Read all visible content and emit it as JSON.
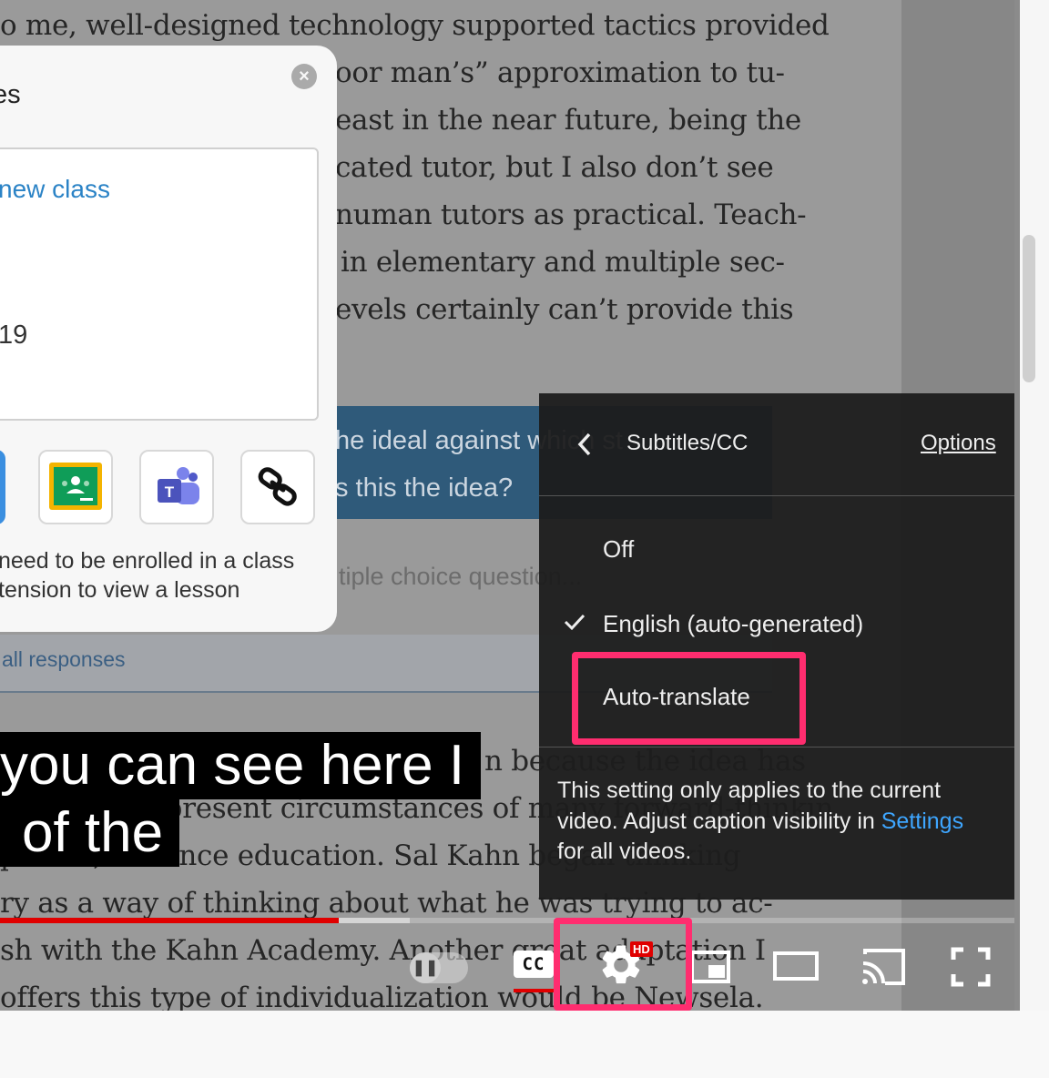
{
  "document": {
    "lines": [
      "o me, well-designed technology supported tactics provided",
      "oor man’s” approximation to tu-",
      "east in the near future, being the",
      "cated tutor, but I also don’t see",
      "numan tutors as practical. Teach-",
      "in elementary and multiple sec-",
      "evels certainly can’t provide this",
      "n because the idea has",
      "aced in the present circumstances of many forward-thinkin",
      "ported, distance education. Sal Kahn began thinking",
      "ry as a way of thinking about what he was trying to ac-",
      "sh with the Kahn Academy. Another great adaptation I",
      "offers this type of individualization would be Newsela."
    ],
    "quiz_banner": {
      "line1": "he ideal against which st",
      "line2": "s this the idea?"
    },
    "quiz_sub": "tiple choice question...",
    "responses_link": "all responses"
  },
  "share_popup": {
    "title": "es",
    "new_class": "new class",
    "year_text": "19",
    "note_line1": "need to be enrolled in a class",
    "note_line2": "tension to view a lesson",
    "buttons": [
      "blue-tile-icon",
      "google-classroom-icon",
      "microsoft-teams-icon",
      "copy-link-icon"
    ]
  },
  "subtitles": {
    "line1": "you can see here I",
    "line2": "of the"
  },
  "player": {
    "progress_fraction": 0.334,
    "buffered_fraction": 0.404,
    "hd_badge": "HD",
    "cc_label": "CC"
  },
  "cc_panel": {
    "title": "Subtitles/CC",
    "options_link": "Options",
    "items": [
      {
        "label": "Off",
        "selected": false
      },
      {
        "label": "English (auto-generated)",
        "selected": true
      },
      {
        "label": "Auto-translate",
        "selected": false
      }
    ],
    "note_before": "This setting only applies to the current video. Adjust caption visibility in",
    "note_link": "Settings",
    "note_after": "for all videos."
  },
  "colors": {
    "highlight": "#ff2d6f",
    "progress_red": "#e00000",
    "link_blue": "#3ea6ff"
  }
}
